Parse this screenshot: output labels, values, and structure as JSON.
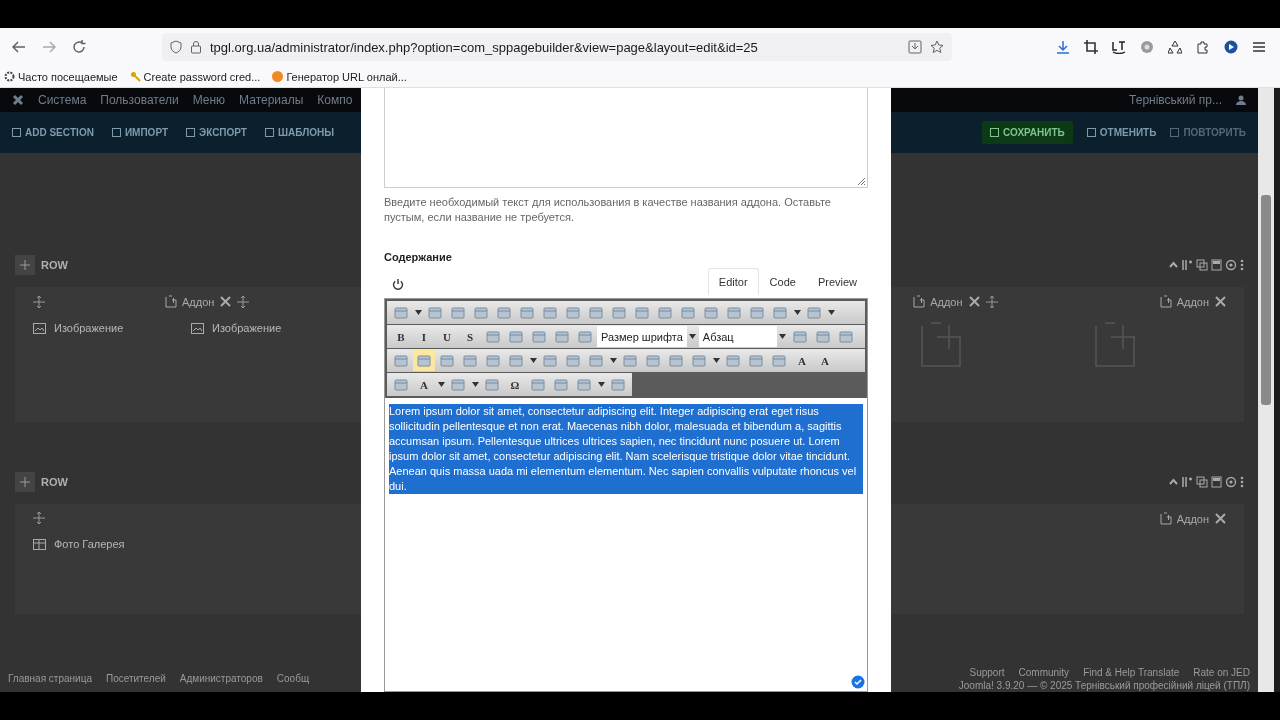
{
  "browser": {
    "url": "tpgl.org.ua/administrator/index.php?option=com_sppagebuilder&view=page&layout=edit&id=25",
    "bookmarks": [
      "Часто посещаемые",
      "Create password cred...",
      "Генератор URL онлай..."
    ]
  },
  "admin_menu": {
    "items": [
      "Система",
      "Пользователи",
      "Меню",
      "Материалы",
      "Компо"
    ],
    "site_link": "Тернівський пр..."
  },
  "builder_toolbar": {
    "left": [
      "ADD SECTION",
      "ИМПОРТ",
      "ЭКСПОРТ",
      "ШАБЛОНЫ"
    ],
    "right": [
      {
        "label": "СОХРАНИТЬ",
        "kind": "primary"
      },
      {
        "label": "ОТМЕНИТЬ",
        "kind": "plain"
      },
      {
        "label": "ПОВТОРИТЬ",
        "kind": "disabled"
      }
    ]
  },
  "rows": [
    {
      "title": "ROW",
      "left": {
        "addon_button": "Аддон",
        "addons": [
          {
            "label": "Изображение",
            "kind": "image"
          },
          {
            "label": "Изображение",
            "kind": "image"
          }
        ]
      },
      "right": {
        "addon_buttons": [
          "Аддон",
          "Аддон"
        ],
        "empty_slots": true
      }
    },
    {
      "title": "ROW",
      "left": {
        "addons": [
          {
            "label": "Фото Галерея",
            "kind": "gallery"
          }
        ]
      },
      "right": {
        "addon_buttons": [
          "Аддон"
        ],
        "empty_slots": false
      }
    }
  ],
  "footer": {
    "left": [
      "Главная страница",
      "Посетителей",
      "Администраторов",
      "Сообщ"
    ],
    "links": [
      "Support",
      "Community",
      "Find & Help Translate",
      "Rate on JED"
    ],
    "copyright": "Joomla! 3.9.20 — © 2025 Тернівський професійний ліцей (ТПЛ)"
  },
  "modal": {
    "help": "Введите необходимый текст для использования в качестве названия аддона. Оставьте пустым, если название не требуется.",
    "content_label": "Содержание",
    "tabs": [
      {
        "label": "Editor",
        "selected": true
      },
      {
        "label": "Code",
        "selected": false
      },
      {
        "label": "Preview",
        "selected": false
      }
    ],
    "toolbar": [
      [
        {
          "kind": "icon",
          "active": false
        },
        {
          "kind": "dropdown"
        },
        {
          "kind": "icon",
          "active": false
        },
        {
          "kind": "icon",
          "active": false
        },
        {
          "kind": "icon",
          "active": false
        },
        {
          "kind": "icon",
          "active": false
        },
        {
          "kind": "icon",
          "active": false
        },
        {
          "kind": "icon",
          "active": false
        },
        {
          "kind": "icon",
          "active": false
        },
        {
          "kind": "icon",
          "active": false
        },
        {
          "kind": "icon",
          "active": false
        },
        {
          "kind": "icon",
          "active": false
        },
        {
          "kind": "icon",
          "active": false
        },
        {
          "kind": "icon",
          "active": false
        },
        {
          "kind": "icon",
          "active": false
        },
        {
          "kind": "icon",
          "active": false
        },
        {
          "kind": "icon",
          "active": false
        },
        {
          "kind": "icon",
          "active": false
        },
        {
          "kind": "dropdown"
        },
        {
          "kind": "icon",
          "active": false
        },
        {
          "kind": "dropdown"
        }
      ],
      [
        {
          "kind": "glyph",
          "text": "B",
          "active": false
        },
        {
          "kind": "glyph",
          "text": "I",
          "active": false
        },
        {
          "kind": "glyph",
          "text": "U",
          "active": false
        },
        {
          "kind": "glyph",
          "text": "S",
          "active": false
        },
        {
          "kind": "icon",
          "active": false
        },
        {
          "kind": "icon",
          "active": false
        },
        {
          "kind": "icon",
          "active": false
        },
        {
          "kind": "icon",
          "active": false
        },
        {
          "kind": "icon",
          "active": false
        },
        {
          "kind": "select",
          "value": "Размер шрифта"
        },
        {
          "kind": "dropdown"
        },
        {
          "kind": "select",
          "value": "Абзац"
        },
        {
          "kind": "dropdown"
        },
        {
          "kind": "icon",
          "active": false
        },
        {
          "kind": "icon",
          "active": false
        },
        {
          "kind": "icon",
          "active": false
        }
      ],
      [
        {
          "kind": "icon",
          "active": false
        },
        {
          "kind": "icon",
          "active": true
        },
        {
          "kind": "icon",
          "active": false
        },
        {
          "kind": "icon",
          "active": false
        },
        {
          "kind": "icon",
          "active": false
        },
        {
          "kind": "icon",
          "active": false
        },
        {
          "kind": "dropdown"
        },
        {
          "kind": "icon",
          "active": false
        },
        {
          "kind": "icon",
          "active": false
        },
        {
          "kind": "icon",
          "active": false
        },
        {
          "kind": "dropdown"
        },
        {
          "kind": "icon",
          "active": false
        },
        {
          "kind": "icon",
          "active": false
        },
        {
          "kind": "icon",
          "active": false
        },
        {
          "kind": "icon",
          "active": false
        },
        {
          "kind": "dropdown"
        },
        {
          "kind": "icon",
          "active": false
        },
        {
          "kind": "icon",
          "active": false
        },
        {
          "kind": "icon",
          "active": false
        },
        {
          "kind": "glyph",
          "text": "A",
          "active": false
        },
        {
          "kind": "glyph",
          "text": "A",
          "active": false
        }
      ],
      [
        {
          "kind": "icon",
          "active": false
        },
        {
          "kind": "glyph",
          "text": "A",
          "active": false
        },
        {
          "kind": "dropdown"
        },
        {
          "kind": "icon",
          "active": false
        },
        {
          "kind": "dropdown"
        },
        {
          "kind": "icon",
          "active": false
        },
        {
          "kind": "glyph",
          "text": "Ω",
          "active": false
        },
        {
          "kind": "icon",
          "active": false
        },
        {
          "kind": "icon",
          "active": false
        },
        {
          "kind": "icon",
          "active": false
        },
        {
          "kind": "dropdown"
        },
        {
          "kind": "icon",
          "active": false
        }
      ]
    ],
    "text": "Lorem ipsum dolor sit amet, consectetur adipiscing elit. Integer adipiscing erat eget risus sollicitudin pellentesque et non erat. Maecenas nibh dolor, malesuada et bibendum a, sagittis accumsan ipsum. Pellentesque ultrices ultrices sapien, nec tincidunt nunc posuere ut. Lorem ipsum dolor sit amet, consectetur adipiscing elit. Nam scelerisque tristique dolor vitae tincidunt. Aenean quis massa uada mi elementum elementum. Nec sapien convallis vulputate rhoncus vel dui.",
    "text_selected": true
  }
}
